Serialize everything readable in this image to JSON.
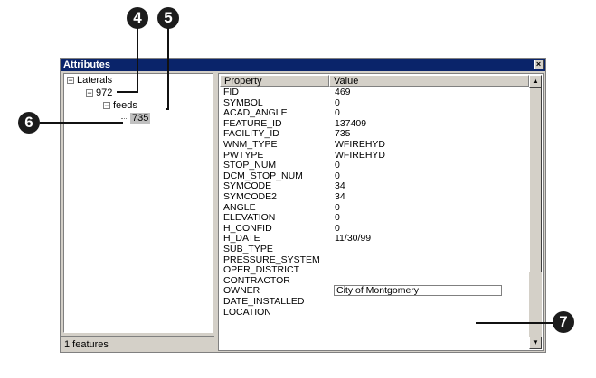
{
  "callouts": [
    "4",
    "5",
    "6",
    "7"
  ],
  "window": {
    "title": "Attributes",
    "close_glyph": "×"
  },
  "tree": {
    "nodes": [
      {
        "label": "Laterals",
        "expander": "−"
      },
      {
        "label": "972",
        "expander": "−"
      },
      {
        "label": "feeds",
        "expander": "−"
      },
      {
        "label": "735",
        "selected": true
      }
    ]
  },
  "grid": {
    "headers": {
      "property": "Property",
      "value": "Value"
    },
    "rows": [
      {
        "property": "FID",
        "value": "469"
      },
      {
        "property": "SYMBOL",
        "value": "0"
      },
      {
        "property": "ACAD_ANGLE",
        "value": "0"
      },
      {
        "property": "FEATURE_ID",
        "value": "137409"
      },
      {
        "property": "FACILITY_ID",
        "value": "735"
      },
      {
        "property": "WNM_TYPE",
        "value": "WFIREHYD"
      },
      {
        "property": "PWTYPE",
        "value": "WFIREHYD"
      },
      {
        "property": "STOP_NUM",
        "value": "0"
      },
      {
        "property": "DCM_STOP_NUM",
        "value": "0"
      },
      {
        "property": "SYMCODE",
        "value": "34"
      },
      {
        "property": "SYMCODE2",
        "value": "34"
      },
      {
        "property": "ANGLE",
        "value": "0"
      },
      {
        "property": "ELEVATION",
        "value": "0"
      },
      {
        "property": "H_CONFID",
        "value": "0"
      },
      {
        "property": "H_DATE",
        "value": "11/30/99"
      },
      {
        "property": "SUB_TYPE",
        "value": ""
      },
      {
        "property": "PRESSURE_SYSTEM",
        "value": ""
      },
      {
        "property": "OPER_DISTRICT",
        "value": ""
      },
      {
        "property": "CONTRACTOR",
        "value": ""
      },
      {
        "property": "OWNER",
        "value": "City of Montgomery",
        "editing": true
      },
      {
        "property": "DATE_INSTALLED",
        "value": ""
      },
      {
        "property": "LOCATION",
        "value": ""
      }
    ]
  },
  "scrollbar": {
    "up": "▲",
    "down": "▼"
  },
  "status": {
    "text": "1 features"
  },
  "colors": {
    "titlebar": "#0a246a",
    "callout": "#1c1c1c",
    "chrome": "#d4d0c8"
  }
}
